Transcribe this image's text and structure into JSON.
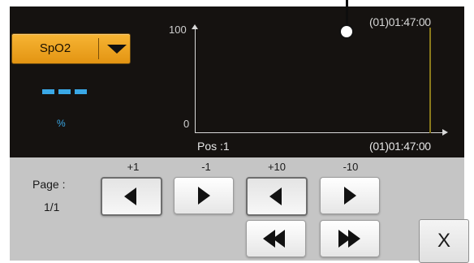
{
  "trend": {
    "parameter_selector": {
      "selected": "SpO2"
    },
    "value": {
      "dashes": "---",
      "unit": "%"
    },
    "y_axis": {
      "max_label": "100",
      "min_label": "0"
    },
    "time_top": "(01)01:47:00",
    "time_bottom": "(01)01:47:00",
    "position": "Pos :1"
  },
  "page": {
    "title": "Page :",
    "value": "1/1"
  },
  "controls": {
    "step_plus1_label": "+1",
    "step_minus1_label": "-1",
    "step_plus10_label": "+10",
    "step_minus10_label": "-10",
    "close_label": "X"
  },
  "colors": {
    "panel_bg": "#151210",
    "selector": "#f0a62a",
    "value_accent": "#3aa8e6",
    "cursor": "#8b7a1c",
    "controls_bg": "#c5c5c5"
  }
}
